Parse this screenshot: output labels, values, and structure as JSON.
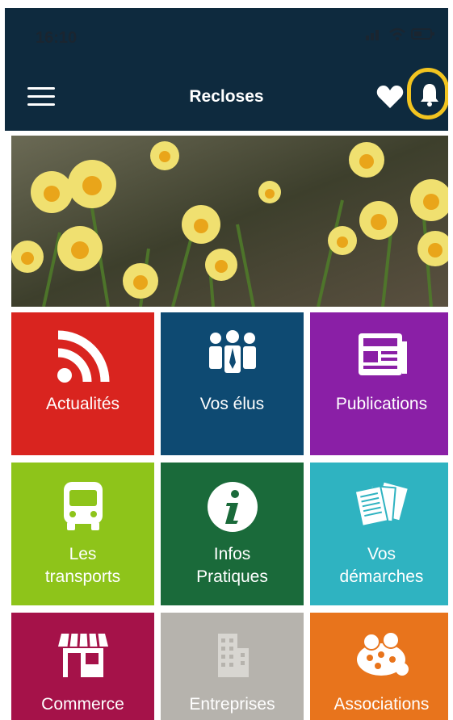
{
  "status": {
    "time": "16:10"
  },
  "header": {
    "title": "Recloses"
  },
  "icons": {
    "menu": "hamburger-menu-icon",
    "favorites": "heart-icon",
    "notifications": "bell-icon"
  },
  "tiles": [
    {
      "line1": "Actualités",
      "line2": "",
      "color": "#d9241f",
      "icon": "rss-icon"
    },
    {
      "line1": "Vos élus",
      "line2": "",
      "color": "#0e4a72",
      "icon": "people-icon"
    },
    {
      "line1": "Publications",
      "line2": "",
      "color": "#8a1fa6",
      "icon": "newspaper-icon"
    },
    {
      "line1": "Les",
      "line2": "transports",
      "color": "#8ec41a",
      "icon": "bus-icon"
    },
    {
      "line1": "Infos",
      "line2": "Pratiques",
      "color": "#1a6a3a",
      "icon": "info-icon"
    },
    {
      "line1": "Vos",
      "line2": "démarches",
      "color": "#2fb3c1",
      "icon": "documents-icon"
    },
    {
      "line1": "Commerce",
      "line2": "",
      "color": "#a51249",
      "icon": "shop-icon"
    },
    {
      "line1": "Entreprises",
      "line2": "",
      "color": "#b6b3ad",
      "icon": "building-icon"
    },
    {
      "line1": "Associations",
      "line2": "",
      "color": "#e8741c",
      "icon": "associations-icon"
    }
  ]
}
